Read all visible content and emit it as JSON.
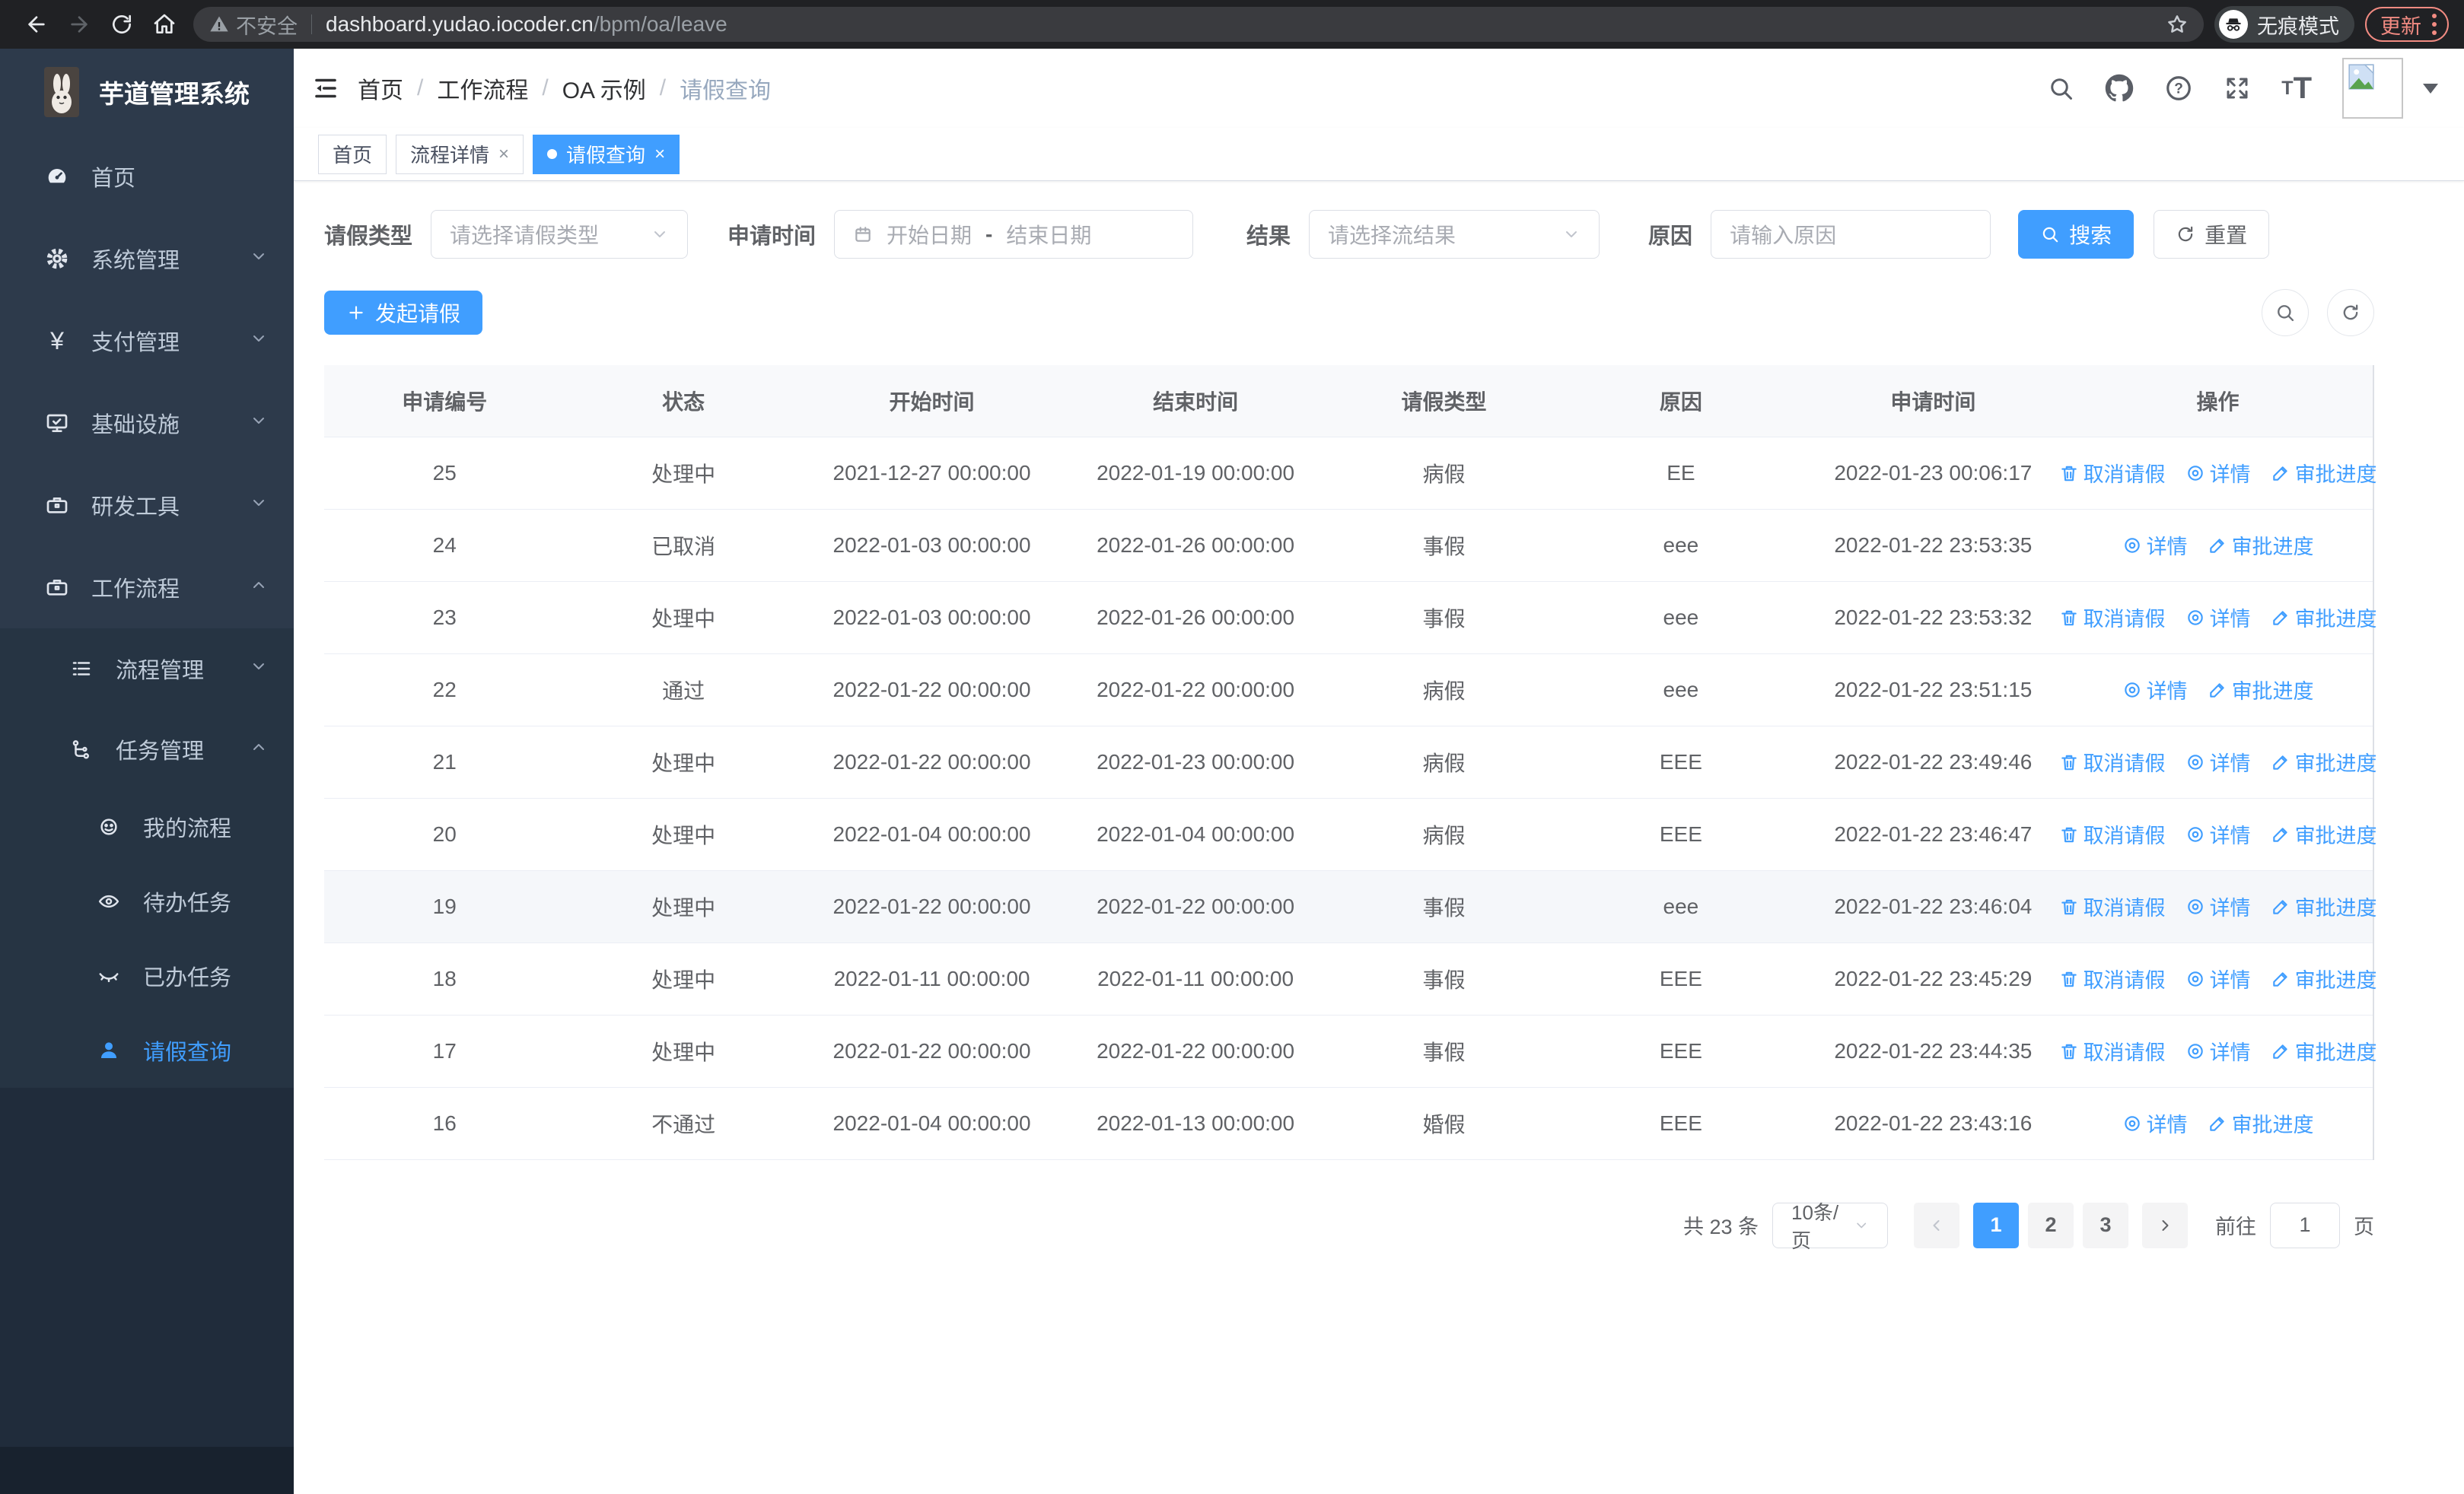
{
  "browser": {
    "security_warning": "不安全",
    "url_host": "dashboard.yudao.iocoder.cn",
    "url_path": "/bpm/oa/leave",
    "incognito_label": "无痕模式",
    "update_label": "更新"
  },
  "logo": {
    "title": "芋道管理系统"
  },
  "sidebar": {
    "items": [
      {
        "label": "首页"
      },
      {
        "label": "系统管理"
      },
      {
        "label": "支付管理"
      },
      {
        "label": "基础设施"
      },
      {
        "label": "研发工具"
      },
      {
        "label": "工作流程"
      }
    ],
    "submenu": [
      {
        "label": "流程管理"
      },
      {
        "label": "任务管理"
      }
    ],
    "leaves": [
      {
        "label": "我的流程"
      },
      {
        "label": "待办任务"
      },
      {
        "label": "已办任务"
      },
      {
        "label": "请假查询"
      }
    ]
  },
  "breadcrumb": {
    "items": [
      "首页",
      "工作流程",
      "OA 示例",
      "请假查询"
    ]
  },
  "tabs": [
    {
      "label": "首页"
    },
    {
      "label": "流程详情"
    },
    {
      "label": "请假查询"
    }
  ],
  "filters": {
    "leave_type_label": "请假类型",
    "leave_type_placeholder": "请选择请假类型",
    "apply_time_label": "申请时间",
    "start_date_placeholder": "开始日期",
    "range_separator": "-",
    "end_date_placeholder": "结束日期",
    "result_label": "结果",
    "result_placeholder": "请选择流结果",
    "reason_label": "原因",
    "reason_placeholder": "请输入原因",
    "search_label": "搜索",
    "reset_label": "重置"
  },
  "toolbar": {
    "create_label": "发起请假"
  },
  "table": {
    "columns": [
      "申请编号",
      "状态",
      "开始时间",
      "结束时间",
      "请假类型",
      "原因",
      "申请时间",
      "操作"
    ],
    "action_labels": {
      "cancel": "取消请假",
      "detail": "详情",
      "progress": "审批进度"
    },
    "rows": [
      {
        "id": "25",
        "status": "处理中",
        "start": "2021-12-27 00:00:00",
        "end": "2022-01-19 00:00:00",
        "type": "病假",
        "reason": "EE",
        "applied": "2022-01-23 00:06:17",
        "actions": [
          "cancel",
          "detail",
          "progress"
        ],
        "hover": false
      },
      {
        "id": "24",
        "status": "已取消",
        "start": "2022-01-03 00:00:00",
        "end": "2022-01-26 00:00:00",
        "type": "事假",
        "reason": "eee",
        "applied": "2022-01-22 23:53:35",
        "actions": [
          "detail",
          "progress"
        ],
        "hover": false
      },
      {
        "id": "23",
        "status": "处理中",
        "start": "2022-01-03 00:00:00",
        "end": "2022-01-26 00:00:00",
        "type": "事假",
        "reason": "eee",
        "applied": "2022-01-22 23:53:32",
        "actions": [
          "cancel",
          "detail",
          "progress"
        ],
        "hover": false
      },
      {
        "id": "22",
        "status": "通过",
        "start": "2022-01-22 00:00:00",
        "end": "2022-01-22 00:00:00",
        "type": "病假",
        "reason": "eee",
        "applied": "2022-01-22 23:51:15",
        "actions": [
          "detail",
          "progress"
        ],
        "hover": false
      },
      {
        "id": "21",
        "status": "处理中",
        "start": "2022-01-22 00:00:00",
        "end": "2022-01-23 00:00:00",
        "type": "病假",
        "reason": "EEE",
        "applied": "2022-01-22 23:49:46",
        "actions": [
          "cancel",
          "detail",
          "progress"
        ],
        "hover": false
      },
      {
        "id": "20",
        "status": "处理中",
        "start": "2022-01-04 00:00:00",
        "end": "2022-01-04 00:00:00",
        "type": "病假",
        "reason": "EEE",
        "applied": "2022-01-22 23:46:47",
        "actions": [
          "cancel",
          "detail",
          "progress"
        ],
        "hover": false
      },
      {
        "id": "19",
        "status": "处理中",
        "start": "2022-01-22 00:00:00",
        "end": "2022-01-22 00:00:00",
        "type": "事假",
        "reason": "eee",
        "applied": "2022-01-22 23:46:04",
        "actions": [
          "cancel",
          "detail",
          "progress"
        ],
        "hover": true
      },
      {
        "id": "18",
        "status": "处理中",
        "start": "2022-01-11 00:00:00",
        "end": "2022-01-11 00:00:00",
        "type": "事假",
        "reason": "EEE",
        "applied": "2022-01-22 23:45:29",
        "actions": [
          "cancel",
          "detail",
          "progress"
        ],
        "hover": false
      },
      {
        "id": "17",
        "status": "处理中",
        "start": "2022-01-22 00:00:00",
        "end": "2022-01-22 00:00:00",
        "type": "事假",
        "reason": "EEE",
        "applied": "2022-01-22 23:44:35",
        "actions": [
          "cancel",
          "detail",
          "progress"
        ],
        "hover": false
      },
      {
        "id": "16",
        "status": "不通过",
        "start": "2022-01-04 00:00:00",
        "end": "2022-01-13 00:00:00",
        "type": "婚假",
        "reason": "EEE",
        "applied": "2022-01-22 23:43:16",
        "actions": [
          "detail",
          "progress"
        ],
        "hover": false
      }
    ]
  },
  "pagination": {
    "total_label": "共 23 条",
    "page_size_label": "10条/页",
    "pages": [
      "1",
      "2",
      "3"
    ],
    "active_page": "1",
    "goto_label": "前往",
    "goto_value": "1",
    "page_unit": "页"
  },
  "colors": {
    "primary": "#409eff",
    "sidebar_bg": "#2d3a4b",
    "update_accent": "#f28b82",
    "link": "#409eff"
  }
}
